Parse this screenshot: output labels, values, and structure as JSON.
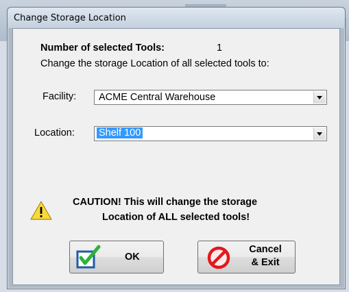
{
  "window": {
    "title": "Change Storage Location"
  },
  "info": {
    "selected_label": "Number of selected Tools:",
    "selected_count": "1",
    "instruction": "Change the storage Location of all selected tools to:"
  },
  "facility": {
    "label": "Facility:",
    "value": "ACME Central Warehouse"
  },
  "location": {
    "label": "Location:",
    "value": "Shelf 100"
  },
  "caution": {
    "line1": "CAUTION!   This will change the storage",
    "line2": "Location of ALL selected tools!"
  },
  "buttons": {
    "ok": "OK",
    "cancel_line1": "Cancel",
    "cancel_line2": "& Exit"
  },
  "icons": {
    "caution": "warning-triangle-icon",
    "ok": "checkmark-icon",
    "cancel": "prohibited-icon"
  },
  "colors": {
    "selection": "#3399ff",
    "warning": "#f7d93c",
    "ok_check": "#2db336",
    "cancel_red": "#e1191e"
  }
}
